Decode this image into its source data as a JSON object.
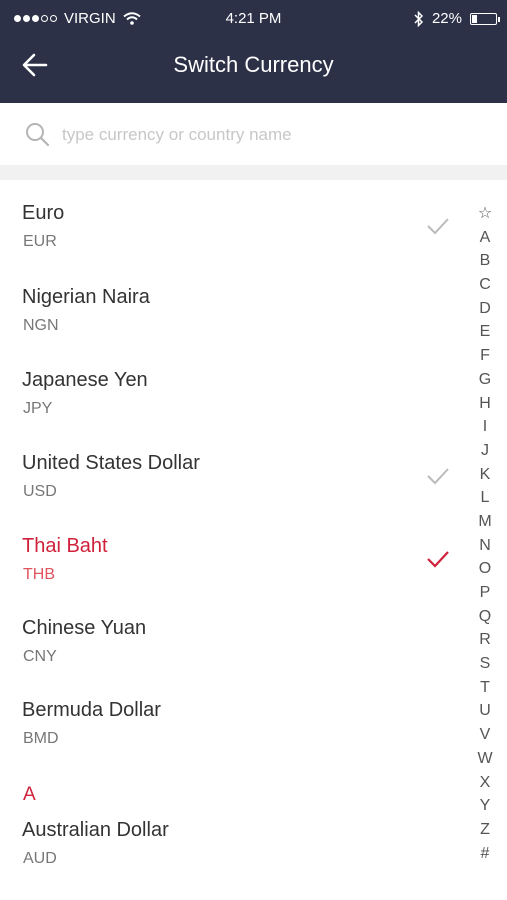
{
  "status_bar": {
    "carrier": "VIRGIN",
    "time": "4:21 PM",
    "battery": "22%",
    "battery_level": 0.22
  },
  "nav": {
    "title": "Switch Currency",
    "back_icon": "arrow-left-icon"
  },
  "search": {
    "placeholder": "type currency or country name",
    "value": ""
  },
  "currencies": [
    {
      "name": "Euro",
      "code": "EUR",
      "check": "grey"
    },
    {
      "name": "Nigerian Naira",
      "code": "NGN",
      "check": ""
    },
    {
      "name": "Japanese Yen",
      "code": "JPY",
      "check": ""
    },
    {
      "name": "United States Dollar",
      "code": "USD",
      "check": "grey"
    },
    {
      "name": "Thai Baht",
      "code": "THB",
      "check": "red"
    },
    {
      "name": "Chinese Yuan",
      "code": "CNY",
      "check": ""
    },
    {
      "name": "Bermuda Dollar",
      "code": "BMD",
      "check": ""
    }
  ],
  "section_a": {
    "header": "A",
    "items": [
      {
        "name": "Australian Dollar",
        "code": "AUD"
      }
    ]
  },
  "index_letters": [
    "☆",
    "A",
    "B",
    "C",
    "D",
    "E",
    "F",
    "G",
    "H",
    "I",
    "J",
    "K",
    "L",
    "M",
    "N",
    "O",
    "P",
    "Q",
    "R",
    "S",
    "T",
    "U",
    "V",
    "W",
    "X",
    "Y",
    "Z",
    "#"
  ],
  "colors": {
    "header_bg": "#2d3147",
    "accent_red": "#d0213b",
    "check_grey": "#bbbbbb"
  }
}
